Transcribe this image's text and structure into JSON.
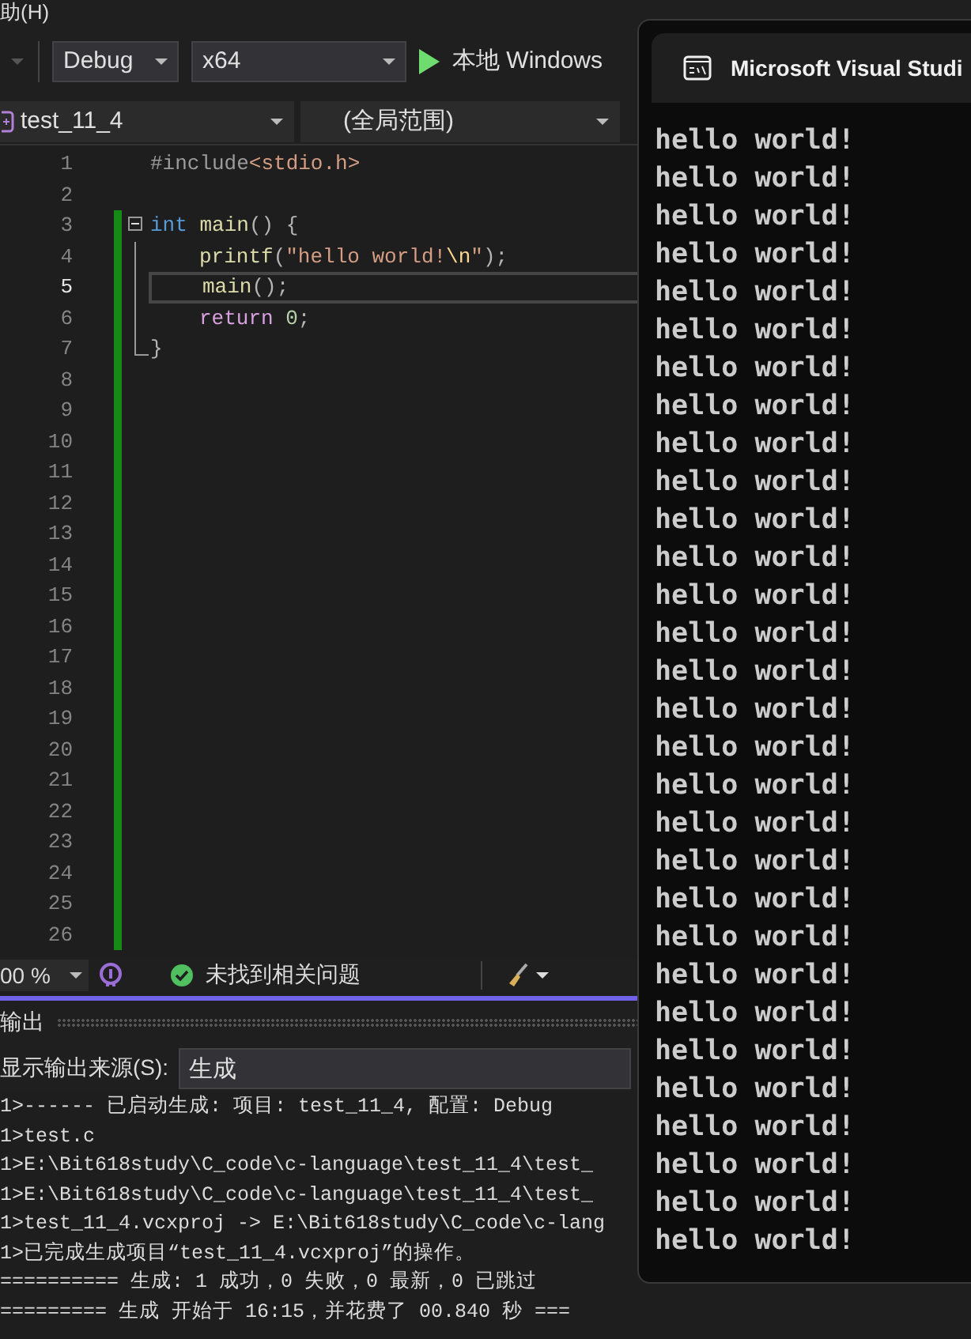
{
  "menu": {
    "partial_item": "助(H)"
  },
  "toolbar": {
    "configuration": "Debug",
    "platform": "x64",
    "run_label": "本地 Windows"
  },
  "navigation": {
    "file": "test_11_4",
    "scope": "(全局范围)"
  },
  "editor": {
    "lines": [
      {
        "number": "1",
        "changed": false,
        "current": false,
        "tokens": [
          {
            "text": "#include",
            "kind": "preproc"
          },
          {
            "text": "<stdio.h>",
            "kind": "string"
          }
        ]
      },
      {
        "number": "2",
        "changed": false,
        "current": false
      },
      {
        "number": "3",
        "changed": true,
        "current": false,
        "expanded": true,
        "tokens": [
          {
            "text": "int ",
            "kind": "keyword"
          },
          {
            "text": "main",
            "kind": "func"
          },
          {
            "text": "() {",
            "kind": "punct"
          }
        ],
        "children": [
          {
            "number": "4",
            "changed": true,
            "current": false,
            "tokens": [
              {
                "text": "printf",
                "kind": "func"
              },
              {
                "text": "(",
                "kind": "punct"
              },
              {
                "text": "\"hello world!",
                "kind": "string"
              },
              {
                "text": "\\n",
                "kind": "escape"
              },
              {
                "text": "\"",
                "kind": "string"
              },
              {
                "text": ");",
                "kind": "punct"
              }
            ]
          },
          {
            "number": "5",
            "changed": true,
            "current": true,
            "tokens": [
              {
                "text": "main",
                "kind": "func"
              },
              {
                "text": "();",
                "kind": "punct"
              }
            ]
          },
          {
            "number": "6",
            "changed": true,
            "current": false,
            "tokens": [
              {
                "text": "return ",
                "kind": "control"
              },
              {
                "text": "0",
                "kind": "number"
              },
              {
                "text": ";",
                "kind": "punct"
              }
            ]
          }
        ]
      },
      {
        "number": "7",
        "changed": true,
        "current": false,
        "tokens": [
          {
            "text": "}",
            "kind": "punct"
          }
        ]
      },
      {
        "number": "8",
        "changed": true,
        "current": false
      },
      {
        "number": "9",
        "changed": true,
        "current": false
      },
      {
        "number": "10",
        "changed": true,
        "current": false
      },
      {
        "number": "11",
        "changed": true,
        "current": false
      },
      {
        "number": "12",
        "changed": true,
        "current": false
      },
      {
        "number": "13",
        "changed": true,
        "current": false
      },
      {
        "number": "14",
        "changed": true,
        "current": false
      },
      {
        "number": "15",
        "changed": true,
        "current": false
      },
      {
        "number": "16",
        "changed": true,
        "current": false
      },
      {
        "number": "17",
        "changed": true,
        "current": false
      },
      {
        "number": "18",
        "changed": true,
        "current": false
      },
      {
        "number": "19",
        "changed": true,
        "current": false
      },
      {
        "number": "20",
        "changed": true,
        "current": false
      },
      {
        "number": "21",
        "changed": true,
        "current": false
      },
      {
        "number": "22",
        "changed": true,
        "current": false
      },
      {
        "number": "23",
        "changed": true,
        "current": false
      },
      {
        "number": "24",
        "changed": true,
        "current": false
      },
      {
        "number": "25",
        "changed": true,
        "current": false
      },
      {
        "number": "26",
        "changed": true,
        "current": false
      }
    ]
  },
  "status_bar": {
    "zoom": "00 %",
    "issues": "未找到相关问题"
  },
  "output_panel": {
    "title": "输出",
    "source_label": "显示输出来源(S):",
    "source": "生成",
    "lines": [
      "1>------ 已启动生成: 项目: test_11_4, 配置: Debug",
      "1>test.c",
      "1>E:\\Bit618study\\C_code\\c-language\\test_11_4\\test_",
      "1>E:\\Bit618study\\C_code\\c-language\\test_11_4\\test_",
      "1>test_11_4.vcxproj -> E:\\Bit618study\\C_code\\c-lang",
      "1>已完成生成项目“test_11_4.vcxproj”的操作。",
      "========== 生成: 1 成功，0 失败，0 最新，0 已跳过",
      "========= 生成 开始于 16:15，并花费了 00.840 秒 ==="
    ]
  },
  "console_window": {
    "title": "Microsoft Visual Studi",
    "lines": [
      "hello world!",
      "hello world!",
      "hello world!",
      "hello world!",
      "hello world!",
      "hello world!",
      "hello world!",
      "hello world!",
      "hello world!",
      "hello world!",
      "hello world!",
      "hello world!",
      "hello world!",
      "hello world!",
      "hello world!",
      "hello world!",
      "hello world!",
      "hello world!",
      "hello world!",
      "hello world!",
      "hello world!",
      "hello world!",
      "hello world!",
      "hello world!",
      "hello world!",
      "hello world!",
      "hello world!",
      "hello world!",
      "hello world!",
      "hello world!"
    ]
  }
}
